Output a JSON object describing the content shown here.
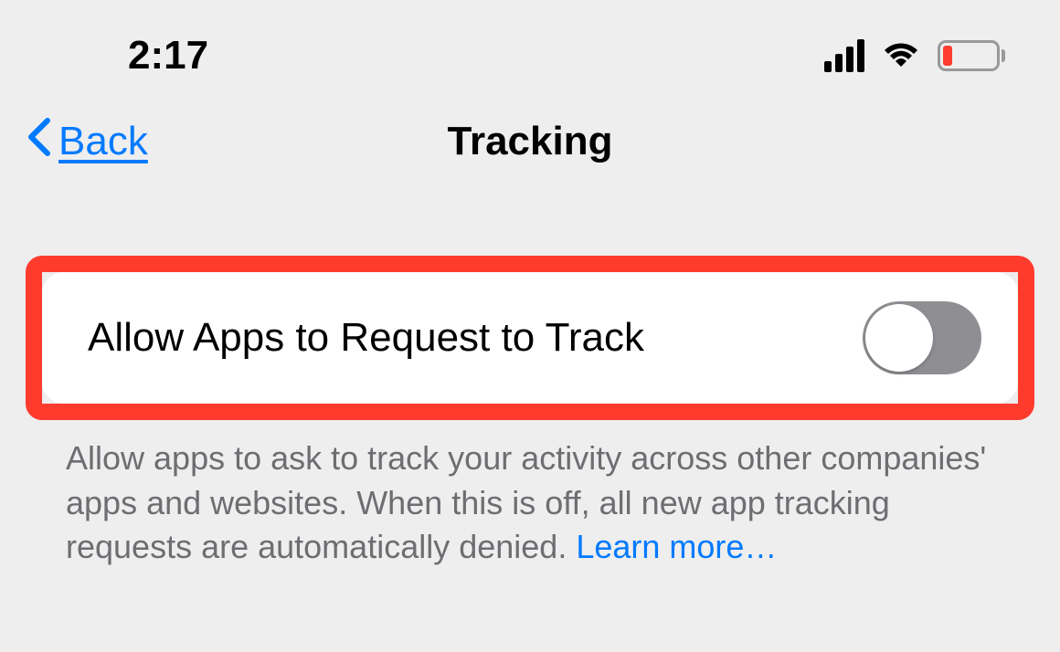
{
  "status_bar": {
    "time": "2:17"
  },
  "nav": {
    "back_label": "Back",
    "title": "Tracking"
  },
  "setting": {
    "label": "Allow Apps to Request to Track",
    "toggle_on": false
  },
  "description": {
    "text": "Allow apps to ask to track your activity across other companies' apps and websites. When this is off, all new app tracking requests are automatically denied. ",
    "learn_more": "Learn more…"
  }
}
